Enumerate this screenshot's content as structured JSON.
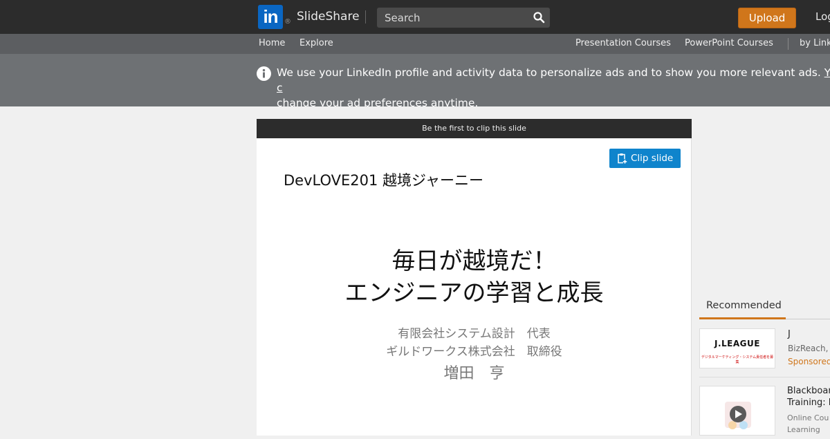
{
  "header": {
    "logo_text": "in",
    "registered": "®",
    "brand": "SlideShare",
    "search_placeholder": "Search",
    "upload_label": "Upload",
    "login_label": "Log"
  },
  "subnav": {
    "home": "Home",
    "explore": "Explore",
    "presentation_courses": "Presentation Courses",
    "powerpoint_courses": "PowerPoint Courses",
    "by_linkedin": "by Link"
  },
  "notice": {
    "text": "We use your LinkedIn profile and activity data to personalize ads and to show you more relevant ads. ",
    "link_part1": "You c",
    "link_part2": "change your ad preferences anytime."
  },
  "slide": {
    "clip_bar": "Be the first to clip this slide",
    "clip_button": "Clip slide",
    "header": "DevLOVE201 越境ジャーニー",
    "title_line1": "毎日が越境だ！",
    "title_line2": "エンジニアの学習と成長",
    "org_line1": "有限会社システム設計　代表",
    "org_line2": "ギルドワークス株式会社　取締役",
    "name": "増田　亨"
  },
  "recommended": {
    "tab_label": "Recommended",
    "items": [
      {
        "thumb_logo": "J.LEAGUE",
        "thumb_sub": "デジタルマーケティング・システム責任者を募集",
        "title": "J",
        "source": "BizReach,",
        "sponsored": "Sponsored"
      },
      {
        "title_line1": "Blackboard",
        "title_line2": "Training: E",
        "source_line1": "Online Cou",
        "source_line2": "Learning"
      }
    ]
  },
  "colors": {
    "accent_orange": "#d0761b",
    "linkedin_blue": "#0a66c2",
    "clip_blue": "#0f84cc"
  }
}
